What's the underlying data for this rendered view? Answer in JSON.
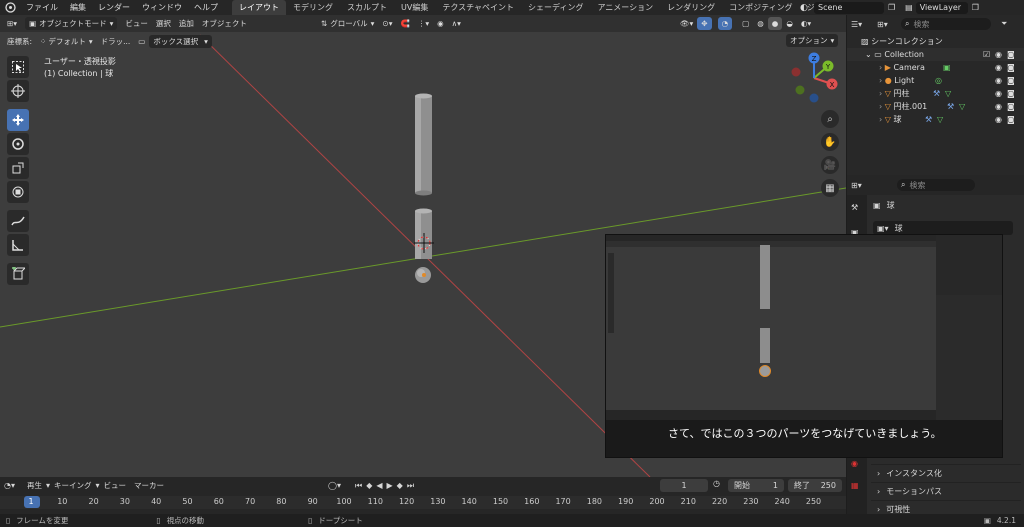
{
  "menu": {
    "items": [
      "ファイル",
      "編集",
      "レンダー",
      "ウィンドウ",
      "ヘルプ"
    ],
    "tabs": [
      "レイアウト",
      "モデリング",
      "スカルプト",
      "UV編集",
      "テクスチャペイント",
      "シェーディング",
      "アニメーション",
      "レンダリング",
      "コンポジティング",
      "ジオメトリ..."
    ],
    "scene": "Scene",
    "view_layer": "ViewLayer"
  },
  "viewport_header": {
    "mode": "オブジェクトモード",
    "menus": [
      "ビュー",
      "選択",
      "追加",
      "オブジェクト"
    ],
    "orientation": "グローバル"
  },
  "viewport_header2": {
    "coord_label": "座標系:",
    "coord_value": "デフォルト",
    "drag_label": "ドラッ...",
    "select_box": "ボックス選択",
    "options": "オプション"
  },
  "viewport": {
    "view_name": "ユーザー・透視投影",
    "collection_info": "(1) Collection | 球"
  },
  "gizmo": {
    "x": "X",
    "y": "Y",
    "z": "Z"
  },
  "outliner": {
    "search_placeholder": "検索",
    "scene_collection": "シーンコレクション",
    "collection": "Collection",
    "items": [
      "Camera",
      "Light",
      "円柱",
      "円柱.001",
      "球"
    ]
  },
  "properties": {
    "search_placeholder": "検索",
    "object_name": "球",
    "object_field": "球",
    "sections": [
      "インスタンス化",
      "モーションパス",
      "可視性"
    ]
  },
  "timeline": {
    "menus": [
      "再生",
      "キーイング",
      "ビュー",
      "マーカー"
    ],
    "current_frame": "1",
    "start_label": "開始",
    "start_value": "1",
    "end_label": "終了",
    "end_value": "250",
    "ticks": [
      "1",
      "10",
      "20",
      "30",
      "40",
      "50",
      "60",
      "70",
      "80",
      "90",
      "100",
      "110",
      "120",
      "130",
      "140",
      "150",
      "160",
      "170",
      "180",
      "190",
      "200",
      "210",
      "220",
      "230",
      "240",
      "250"
    ]
  },
  "statusbar": {
    "items": [
      "フレームを変更",
      "視点の移動",
      "ドープシート"
    ],
    "version": "4.2.1"
  },
  "pip": {
    "subtitle": "さて、ではこの３つのパーツをつなげていきましょう。"
  }
}
